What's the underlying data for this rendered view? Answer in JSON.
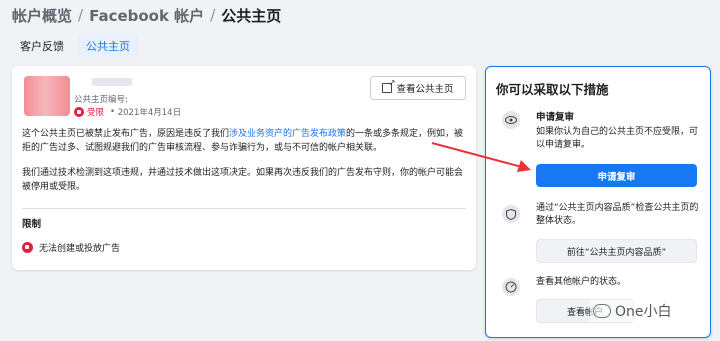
{
  "breadcrumb": {
    "items": [
      "帐户概览",
      "Facebook 帐户",
      "公共主页"
    ],
    "separator": "/"
  },
  "tabs": [
    {
      "label": "客户反馈",
      "active": false
    },
    {
      "label": "公共主页",
      "active": true
    }
  ],
  "page_card": {
    "page_id_label": "公共主页编号:",
    "status": "受限",
    "date": "2021年4月14日",
    "view_button": "查看公共主页",
    "para1_before": "这个公共主页已被禁止发布广告，原因是违反了我们",
    "para1_link": "涉及业务资产的广告发布政策",
    "para1_after": "的一条或多条规定，例如，被拒的广告过多、试图规避我们的广告审核流程、参与诈骗行为，或与不可信的帐户相关联。",
    "para2": "我们通过技术检测到这项违规，并通过技术做出这项决定。如果再次违反我们的广告发布守则，你的帐户可能会被停用或受限。",
    "limit_heading": "限制",
    "limit_item": "无法创建或投放广告"
  },
  "actions_card": {
    "title": "你可以采取以下措施",
    "appeal_heading": "申请复审",
    "appeal_text": "如果你认为自己的公共主页不应受限，可以申请复审。",
    "appeal_button": "申请复审",
    "quality_text": "通过“公共主页内容品质”检查公共主页的整体状态。",
    "quality_button": "前往“公共主页内容品质”",
    "other_text": "查看其他帐户的状态。",
    "other_button": "查看帐户"
  },
  "watermark": "One小白",
  "colors": {
    "accent": "#1877f2",
    "restricted": "#e41e3f",
    "arrow": "#e8323c"
  }
}
